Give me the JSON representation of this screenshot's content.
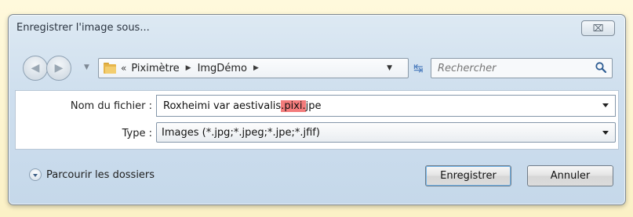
{
  "dialog": {
    "title": "Enregistrer l'image sous...",
    "close_glyph": "⌧"
  },
  "nav": {
    "back_glyph": "◀",
    "forward_glyph": "▶",
    "recent_glyph": "▼",
    "breadcrumb_prefix": "«",
    "breadcrumb": [
      "Piximètre",
      "ImgDémo"
    ],
    "crumb_separator": "▶",
    "refresh_glyph": "↹",
    "search_placeholder": "Rechercher",
    "icons": {
      "folder": "folder-icon",
      "refresh": "refresh-icon",
      "search": "search-icon"
    }
  },
  "form": {
    "name_label": "Nom du fichier :",
    "name_value_before": "Roxheimi var aestivalis",
    "name_value_selected": ".pixi.",
    "name_value_after": "jpe",
    "type_label": "Type :",
    "type_value": "Images  (*.jpg;*.jpeg;*.jpe;*.jfif)",
    "selection_color": "#f37c7c"
  },
  "footer": {
    "browse_label": "Parcourir les dossiers",
    "save_label": "Enregistrer",
    "cancel_label": "Annuler"
  }
}
